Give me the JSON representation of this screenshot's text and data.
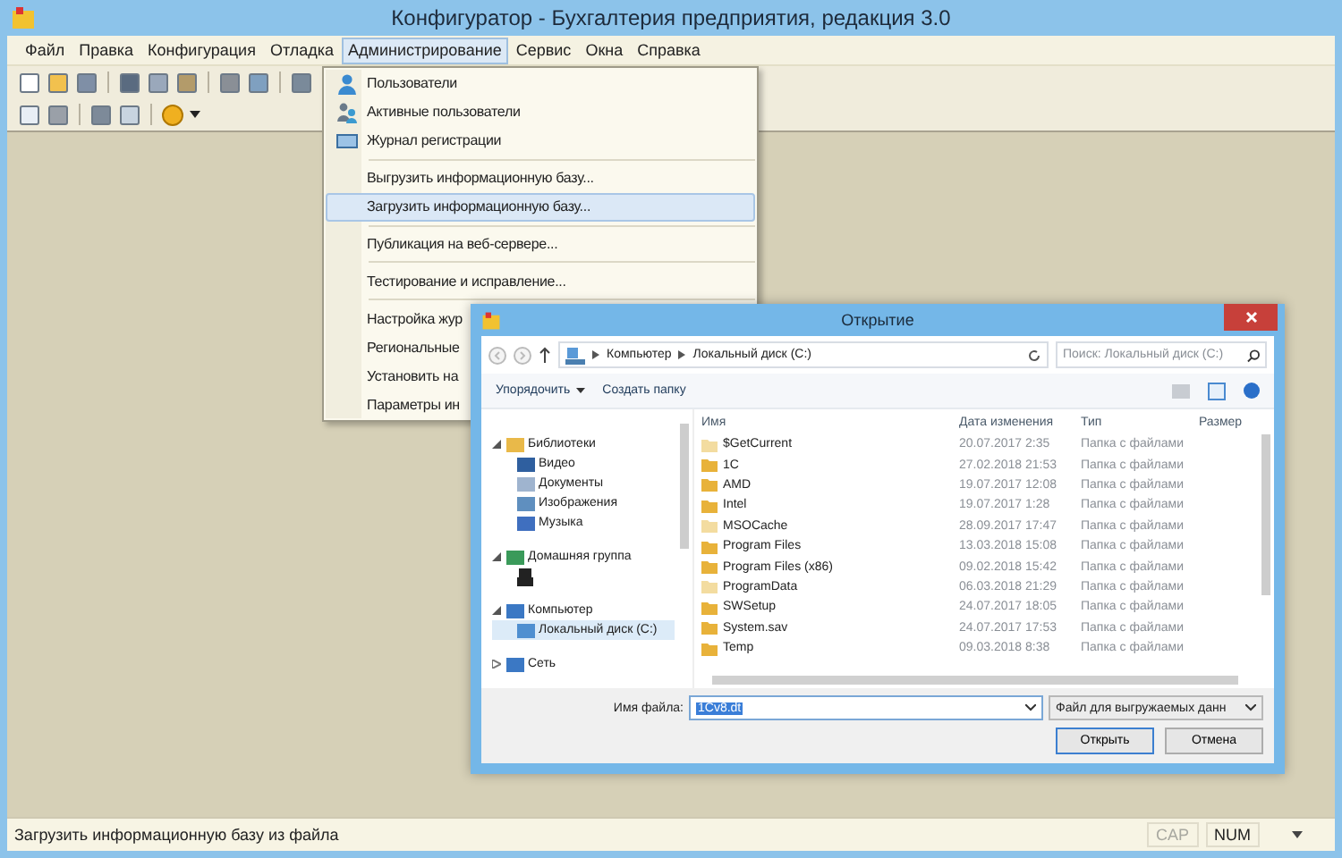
{
  "window": {
    "title": "Конфигуратор - Бухгалтерия предприятия, редакция 3.0"
  },
  "menu_bar": [
    {
      "label": "Файл",
      "selected": false
    },
    {
      "label": "Правка",
      "selected": false
    },
    {
      "label": "Конфигурация",
      "selected": false
    },
    {
      "label": "Отладка",
      "selected": false
    },
    {
      "label": "Администрирование",
      "selected": true
    },
    {
      "label": "Сервис",
      "selected": false
    },
    {
      "label": "Окна",
      "selected": false
    },
    {
      "label": "Справка",
      "selected": false
    }
  ],
  "dropdown": {
    "sections": [
      {
        "items": [
          {
            "label": "Пользователи",
            "kind": "user",
            "selected": false
          },
          {
            "label": "Активные пользователи",
            "kind": "users",
            "selected": false
          },
          {
            "label": "Журнал регистрации",
            "kind": "journal",
            "selected": false
          }
        ]
      },
      {
        "items": [
          {
            "label": "Выгрузить информационную базу...",
            "selected": false
          },
          {
            "label": "Загрузить информационную базу...",
            "selected": true
          }
        ]
      },
      {
        "items": [
          {
            "label": "Публикация на веб-сервере...",
            "selected": false
          }
        ]
      },
      {
        "items": [
          {
            "label": "Тестирование и исправление...",
            "selected": false
          }
        ]
      },
      {
        "items": [
          {
            "label": "Настройка жур",
            "selected": false
          },
          {
            "label": "Региональные",
            "selected": false
          },
          {
            "label": "Установить на",
            "selected": false
          },
          {
            "label": "Параметры ин",
            "selected": false
          }
        ]
      }
    ]
  },
  "dialog": {
    "title": "Открытие",
    "breadcrumbs": [
      "Компьютер",
      "Локальный диск (C:)"
    ],
    "search": {
      "placeholder": "Поиск: Локальный диск (C:)"
    },
    "toolbar": {
      "organize": "Упорядочить",
      "new_folder": "Создать папку"
    },
    "tree": [
      {
        "label": "Библиотеки",
        "kind": "library",
        "expanded": true,
        "children": [
          {
            "label": "Видео",
            "kind": "video",
            "selected": false
          },
          {
            "label": "Документы",
            "kind": "docs",
            "selected": false
          },
          {
            "label": "Изображения",
            "kind": "images",
            "selected": false
          },
          {
            "label": "Музыка",
            "kind": "music",
            "selected": false
          }
        ]
      },
      {
        "label": "Домашняя группа",
        "kind": "homegroup",
        "expanded": true,
        "children": [
          {
            "kind": "person",
            "selected": false
          }
        ]
      },
      {
        "label": "Компьютер",
        "kind": "computer",
        "expanded": true,
        "children": [
          {
            "label": "Локальный диск (C:)",
            "kind": "drive",
            "selected": true
          }
        ]
      },
      {
        "label": "Сеть",
        "kind": "network",
        "expanded": false
      }
    ],
    "columns": [
      "Имя",
      "Дата изменения",
      "Тип",
      "Размер"
    ],
    "files": [
      {
        "name": "$GetCurrent",
        "date": "20.07.2017 2:35",
        "type": "Папка с файлами",
        "hidden": true
      },
      {
        "name": "1C",
        "date": "27.02.2018 21:53",
        "type": "Папка с файлами",
        "hidden": false
      },
      {
        "name": "AMD",
        "date": "19.07.2017 12:08",
        "type": "Папка с файлами",
        "hidden": false
      },
      {
        "name": "Intel",
        "date": "19.07.2017 1:28",
        "type": "Папка с файлами",
        "hidden": false
      },
      {
        "name": "MSOCache",
        "date": "28.09.2017 17:47",
        "type": "Папка с файлами",
        "hidden": true
      },
      {
        "name": "Program Files",
        "date": "13.03.2018 15:08",
        "type": "Папка с файлами",
        "hidden": false
      },
      {
        "name": "Program Files (x86)",
        "date": "09.02.2018 15:42",
        "type": "Папка с файлами",
        "hidden": false
      },
      {
        "name": "ProgramData",
        "date": "06.03.2018 21:29",
        "type": "Папка с файлами",
        "hidden": true
      },
      {
        "name": "SWSetup",
        "date": "24.07.2017 18:05",
        "type": "Папка с файлами",
        "hidden": false
      },
      {
        "name": "System.sav",
        "date": "24.07.2017 17:53",
        "type": "Папка с файлами",
        "hidden": false
      },
      {
        "name": "Temp",
        "date": "09.03.2018 8:38",
        "type": "Папка с файлами",
        "hidden": false
      }
    ],
    "filename_label": "Имя файла:",
    "filename": "1Cv8.dt",
    "filter": "Файл для выгружаемых данн",
    "buttons": [
      "Открыть",
      "Отмена"
    ]
  },
  "status_bar": {
    "text": "Загрузить информационную базу из файла",
    "indicators": [
      {
        "label": "CAP",
        "on": false
      },
      {
        "label": "NUM",
        "on": true
      }
    ]
  }
}
